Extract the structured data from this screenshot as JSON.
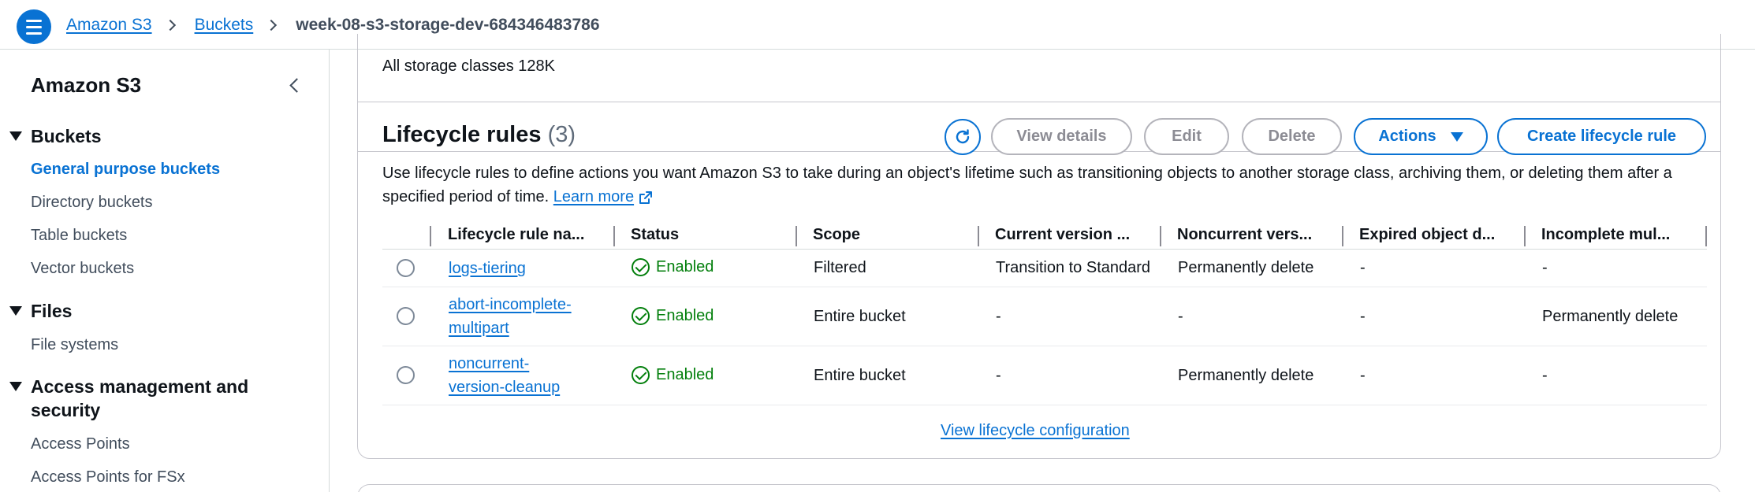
{
  "breadcrumb": {
    "items": [
      "Amazon S3",
      "Buckets"
    ],
    "current": "week-08-s3-storage-dev-684346483786"
  },
  "sidebar": {
    "title": "Amazon S3",
    "sections": [
      {
        "label": "Buckets",
        "items": [
          "General purpose buckets",
          "Directory buckets",
          "Table buckets",
          "Vector buckets"
        ]
      },
      {
        "label": "Files",
        "items": [
          "File systems"
        ]
      },
      {
        "label": "Access management and security",
        "items": [
          "Access Points",
          "Access Points for FSx"
        ]
      }
    ],
    "active_item": "General purpose buckets"
  },
  "storage": {
    "summary": "All storage classes 128K"
  },
  "lifecycle": {
    "title": "Lifecycle rules",
    "count": "(3)",
    "buttons": {
      "view_details": "View details",
      "edit": "Edit",
      "delete": "Delete",
      "actions": "Actions",
      "create": "Create lifecycle rule"
    },
    "description": "Use lifecycle rules to define actions you want Amazon S3 to take during an object's lifetime such as transitioning objects to another storage class, archiving them, or deleting them after a specified period of time.",
    "learn_more": "Learn more",
    "columns": [
      "Lifecycle rule na...",
      "Status",
      "Scope",
      "Current version ...",
      "Noncurrent vers...",
      "Expired object d...",
      "Incomplete mul..."
    ],
    "rows": [
      {
        "name_line1": "logs-tiering",
        "name_line2": "",
        "status": "Enabled",
        "scope": "Filtered",
        "current": "Transition to Standard",
        "noncurrent": "Permanently delete",
        "expired": "-",
        "incomplete": "-"
      },
      {
        "name_line1": "abort-incomplete-",
        "name_line2": "multipart",
        "status": "Enabled",
        "scope": "Entire bucket",
        "current": "-",
        "noncurrent": "-",
        "expired": "-",
        "incomplete": "Permanently delete"
      },
      {
        "name_line1": "noncurrent-",
        "name_line2": "version-cleanup",
        "status": "Enabled",
        "scope": "Entire bucket",
        "current": "-",
        "noncurrent": "Permanently delete",
        "expired": "-",
        "incomplete": "-"
      }
    ],
    "view_config": "View lifecycle configuration"
  },
  "colors": {
    "accent": "#0972d3",
    "success": "#037f0c",
    "text": "#0f141a",
    "muted": "#414d5c"
  },
  "icons": {
    "menu": "hamburger-icon",
    "collapse": "chevron-left-icon",
    "refresh": "refresh-icon",
    "external": "external-link-icon",
    "status_ok": "check-circle-icon"
  }
}
